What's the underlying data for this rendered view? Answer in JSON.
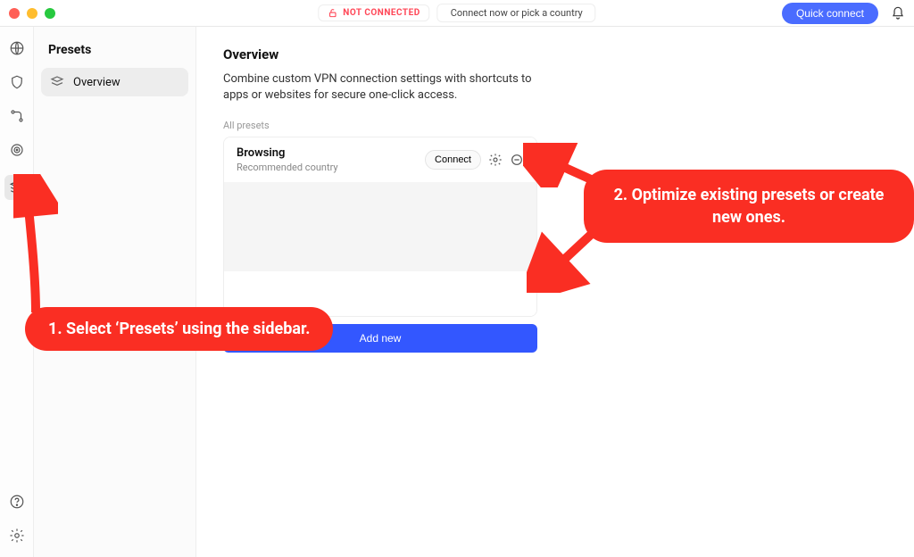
{
  "titlebar": {
    "status_label": "NOT CONNECTED",
    "hint": "Connect now or pick a country",
    "quick_connect": "Quick connect"
  },
  "iconbar": {
    "items": [
      "globe",
      "shield",
      "routing",
      "target",
      "presets"
    ],
    "bottom": [
      "help",
      "settings"
    ],
    "selected": "presets"
  },
  "subnav": {
    "title": "Presets",
    "items": [
      {
        "icon": "layers",
        "label": "Overview",
        "selected": true
      }
    ]
  },
  "overview": {
    "heading": "Overview",
    "description": "Combine custom VPN connection settings with shortcuts to apps or websites for secure one-click access.",
    "all_label": "All presets",
    "preset": {
      "name": "Browsing",
      "subtitle": "Recommended country",
      "connect_label": "Connect"
    },
    "add_label": "Add new"
  },
  "annotations": {
    "step1": "1. Select ‘Presets’ using the sidebar.",
    "step2": "2. Optimize existing presets or create new ones."
  }
}
